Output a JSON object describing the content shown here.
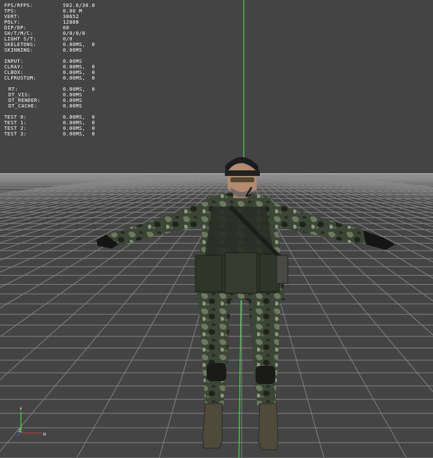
{
  "stats": [
    {
      "label": "FPS/RFPS:",
      "value": "502.6/30.0"
    },
    {
      "label": "TPS:",
      "value": "0.00 M"
    },
    {
      "label": "VERT:",
      "value": "38652"
    },
    {
      "label": "POLY:",
      "value": "12888"
    },
    {
      "label": "DIP/DP:",
      "value": "60"
    },
    {
      "label": "SH/T/M/C:",
      "value": "0/0/0/0"
    },
    {
      "label": "LIGHT S/T:",
      "value": "0/0"
    },
    {
      "label": "SKELETONS:",
      "value": "0.00MS,  0"
    },
    {
      "label": "SKINNING:",
      "value": "0.00MS"
    },
    {
      "label": "INPUT:",
      "value": "0.00MS"
    },
    {
      "label": "CLRAY:",
      "value": "0.00MS,  0"
    },
    {
      "label": "CLBOX:",
      "value": "0.00MS,  0"
    },
    {
      "label": "CLFRUSTUM:",
      "value": "0.00MS,  0"
    },
    {
      "label": "RT:",
      "value": "0.00MS,  0"
    },
    {
      "label": "DT_VIS:",
      "value": "0.00MS"
    },
    {
      "label": "DT_RENDER:",
      "value": "0.00MS"
    },
    {
      "label": "DT_CACHE:",
      "value": "0.00MS"
    },
    {
      "label": "TEST 0:",
      "value": "0.00MS,  0"
    },
    {
      "label": "TEST 1:",
      "value": "0.00MS,  0"
    },
    {
      "label": "TEST 2:",
      "value": "0.00MS,  0"
    },
    {
      "label": "TEST 3:",
      "value": "0.00MS,  0"
    }
  ],
  "axis": {
    "y_label": "Y",
    "z_label": "Z",
    "x_label": "H"
  },
  "colors": {
    "background": "#444444",
    "grid": "#8a8a8a",
    "green_axis": "#3cff3c",
    "red_axis": "#e03030",
    "blue_axis": "#3060ff",
    "text": "#ffffff"
  }
}
